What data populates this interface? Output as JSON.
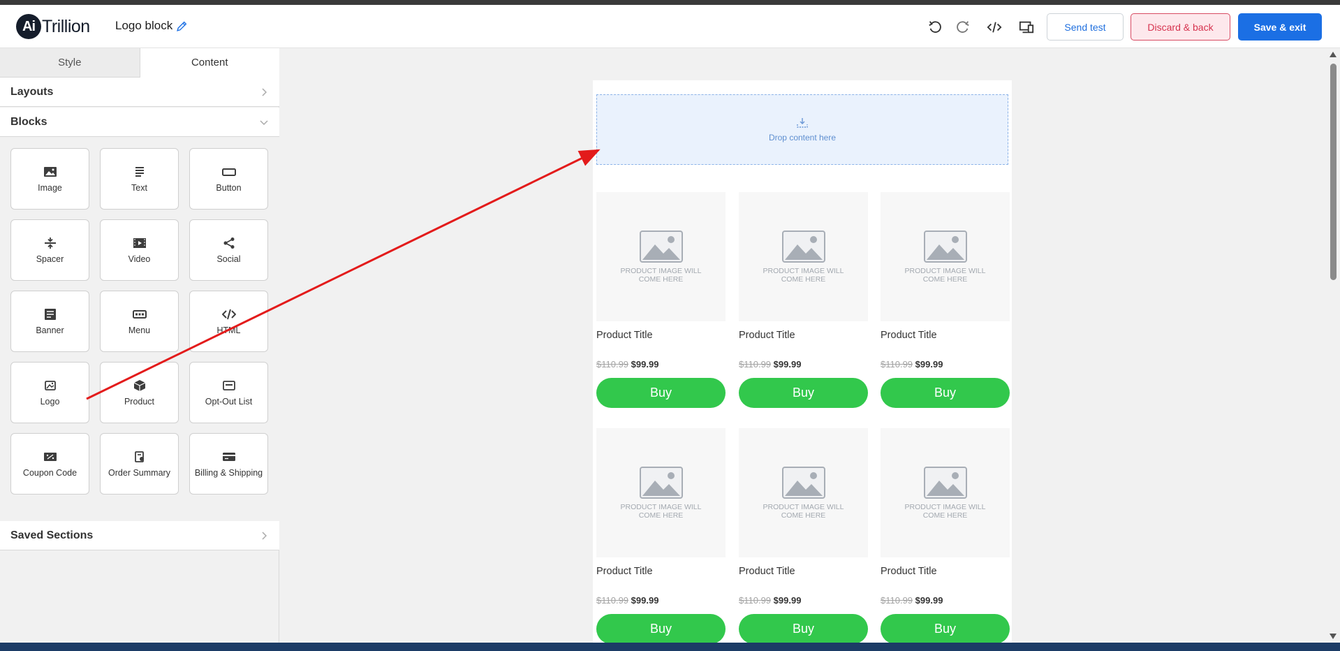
{
  "header": {
    "logo_mark": "Ai",
    "logo_word": "Trillion",
    "block_title": "Logo block",
    "send_test": "Send test",
    "discard": "Discard & back",
    "save": "Save & exit"
  },
  "sidebar": {
    "tabs": [
      "Style",
      "Content"
    ],
    "sections": {
      "layouts": "Layouts",
      "blocks": "Blocks",
      "saved": "Saved Sections"
    },
    "blocks": [
      {
        "label": "Image",
        "icon": "image-icon"
      },
      {
        "label": "Text",
        "icon": "text-icon"
      },
      {
        "label": "Button",
        "icon": "button-icon"
      },
      {
        "label": "Spacer",
        "icon": "spacer-icon"
      },
      {
        "label": "Video",
        "icon": "video-icon"
      },
      {
        "label": "Social",
        "icon": "share-icon"
      },
      {
        "label": "Banner",
        "icon": "banner-icon"
      },
      {
        "label": "Menu",
        "icon": "menu-icon"
      },
      {
        "label": "HTML",
        "icon": "code-icon"
      },
      {
        "label": "Logo",
        "icon": "logo-icon"
      },
      {
        "label": "Product",
        "icon": "product-icon"
      },
      {
        "label": "Opt-Out List",
        "icon": "optout-icon"
      },
      {
        "label": "Coupon Code",
        "icon": "coupon-icon"
      },
      {
        "label": "Order Summary",
        "icon": "order-summary-icon"
      },
      {
        "label": "Billing & Shipping",
        "icon": "card-icon"
      }
    ]
  },
  "canvas": {
    "drop_text": "Drop content here",
    "products": [
      {
        "image_text": "PRODUCT IMAGE WILL COME HERE",
        "title": "Product Title",
        "old_price": "$110.99",
        "new_price": "$99.99",
        "buy": "Buy"
      },
      {
        "image_text": "PRODUCT IMAGE WILL COME HERE",
        "title": "Product Title",
        "old_price": "$110.99",
        "new_price": "$99.99",
        "buy": "Buy"
      },
      {
        "image_text": "PRODUCT IMAGE WILL COME HERE",
        "title": "Product Title",
        "old_price": "$110.99",
        "new_price": "$99.99",
        "buy": "Buy"
      },
      {
        "image_text": "PRODUCT IMAGE WILL COME HERE",
        "title": "Product Title",
        "old_price": "$110.99",
        "new_price": "$99.99",
        "buy": "Buy"
      },
      {
        "image_text": "PRODUCT IMAGE WILL COME HERE",
        "title": "Product Title",
        "old_price": "$110.99",
        "new_price": "$99.99",
        "buy": "Buy"
      },
      {
        "image_text": "PRODUCT IMAGE WILL COME HERE",
        "title": "Product Title",
        "old_price": "$110.99",
        "new_price": "$99.99",
        "buy": "Buy"
      }
    ]
  },
  "colors": {
    "accent": "#1b6fe4",
    "discard": "#d6334f",
    "buy": "#32c84c",
    "annotation_arrow": "#e31b1b"
  }
}
